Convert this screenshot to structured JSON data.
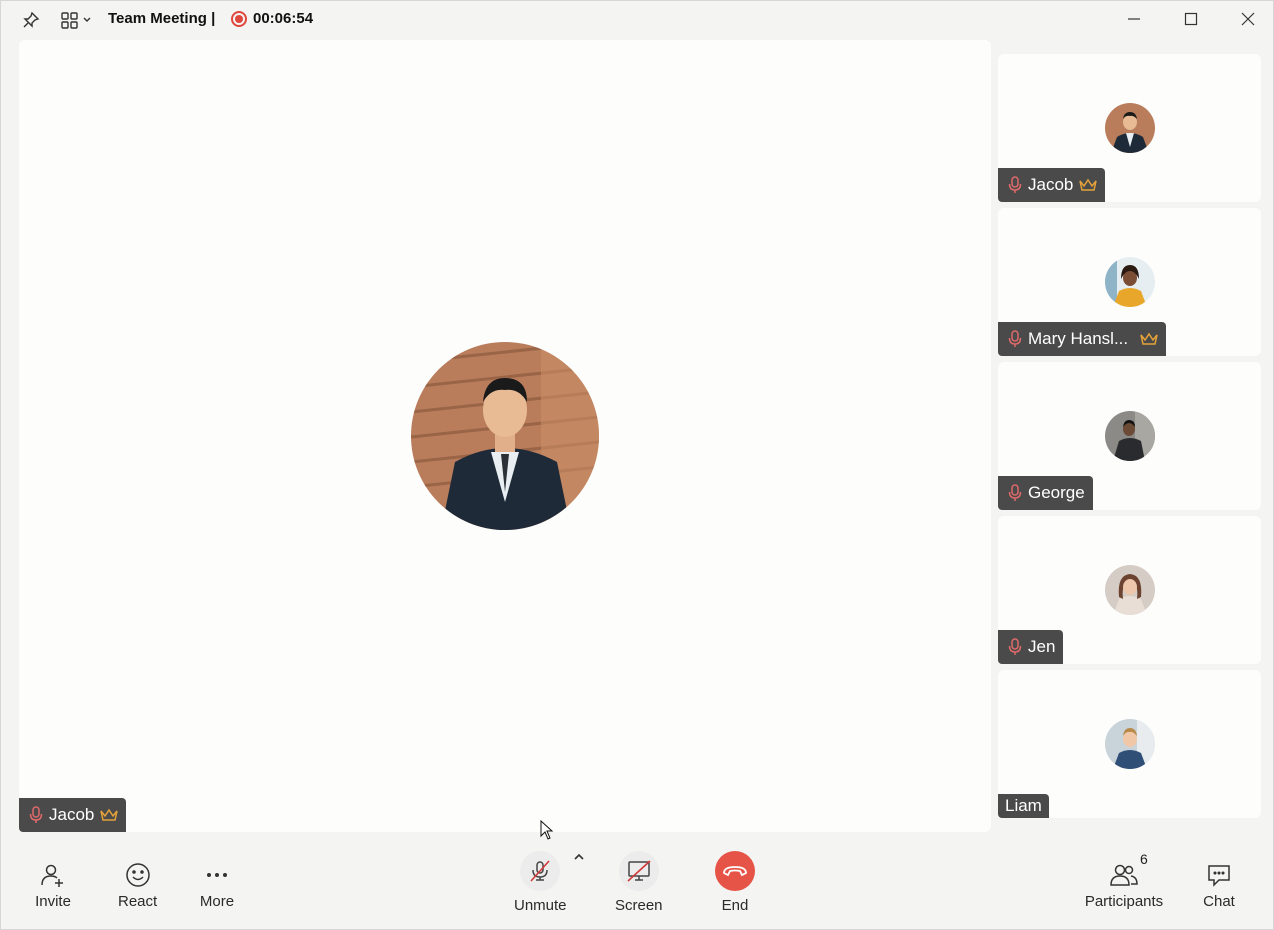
{
  "titlebar": {
    "title": "Team Meeting |",
    "timer": "00:06:54"
  },
  "stage": {
    "speaker_name": "Jacob"
  },
  "participants_tiles": [
    {
      "name": "Jacob",
      "host": true,
      "muted": true
    },
    {
      "name": "Mary Hansl...",
      "host": true,
      "muted": true
    },
    {
      "name": "George",
      "host": false,
      "muted": true
    },
    {
      "name": "Jen",
      "host": false,
      "muted": true
    },
    {
      "name": "Liam",
      "host": false,
      "muted": false
    }
  ],
  "toolbar": {
    "invite": "Invite",
    "react": "React",
    "more": "More",
    "unmute": "Unmute",
    "screen": "Screen",
    "end": "End",
    "participants": "Participants",
    "participants_count": "6",
    "chat": "Chat"
  },
  "colors": {
    "record": "#e0473c",
    "end_button": "#e55446",
    "crown": "#e5a23a",
    "mic_muted": "#d23a3a",
    "name_tag_bg": "#4a4a4a"
  }
}
